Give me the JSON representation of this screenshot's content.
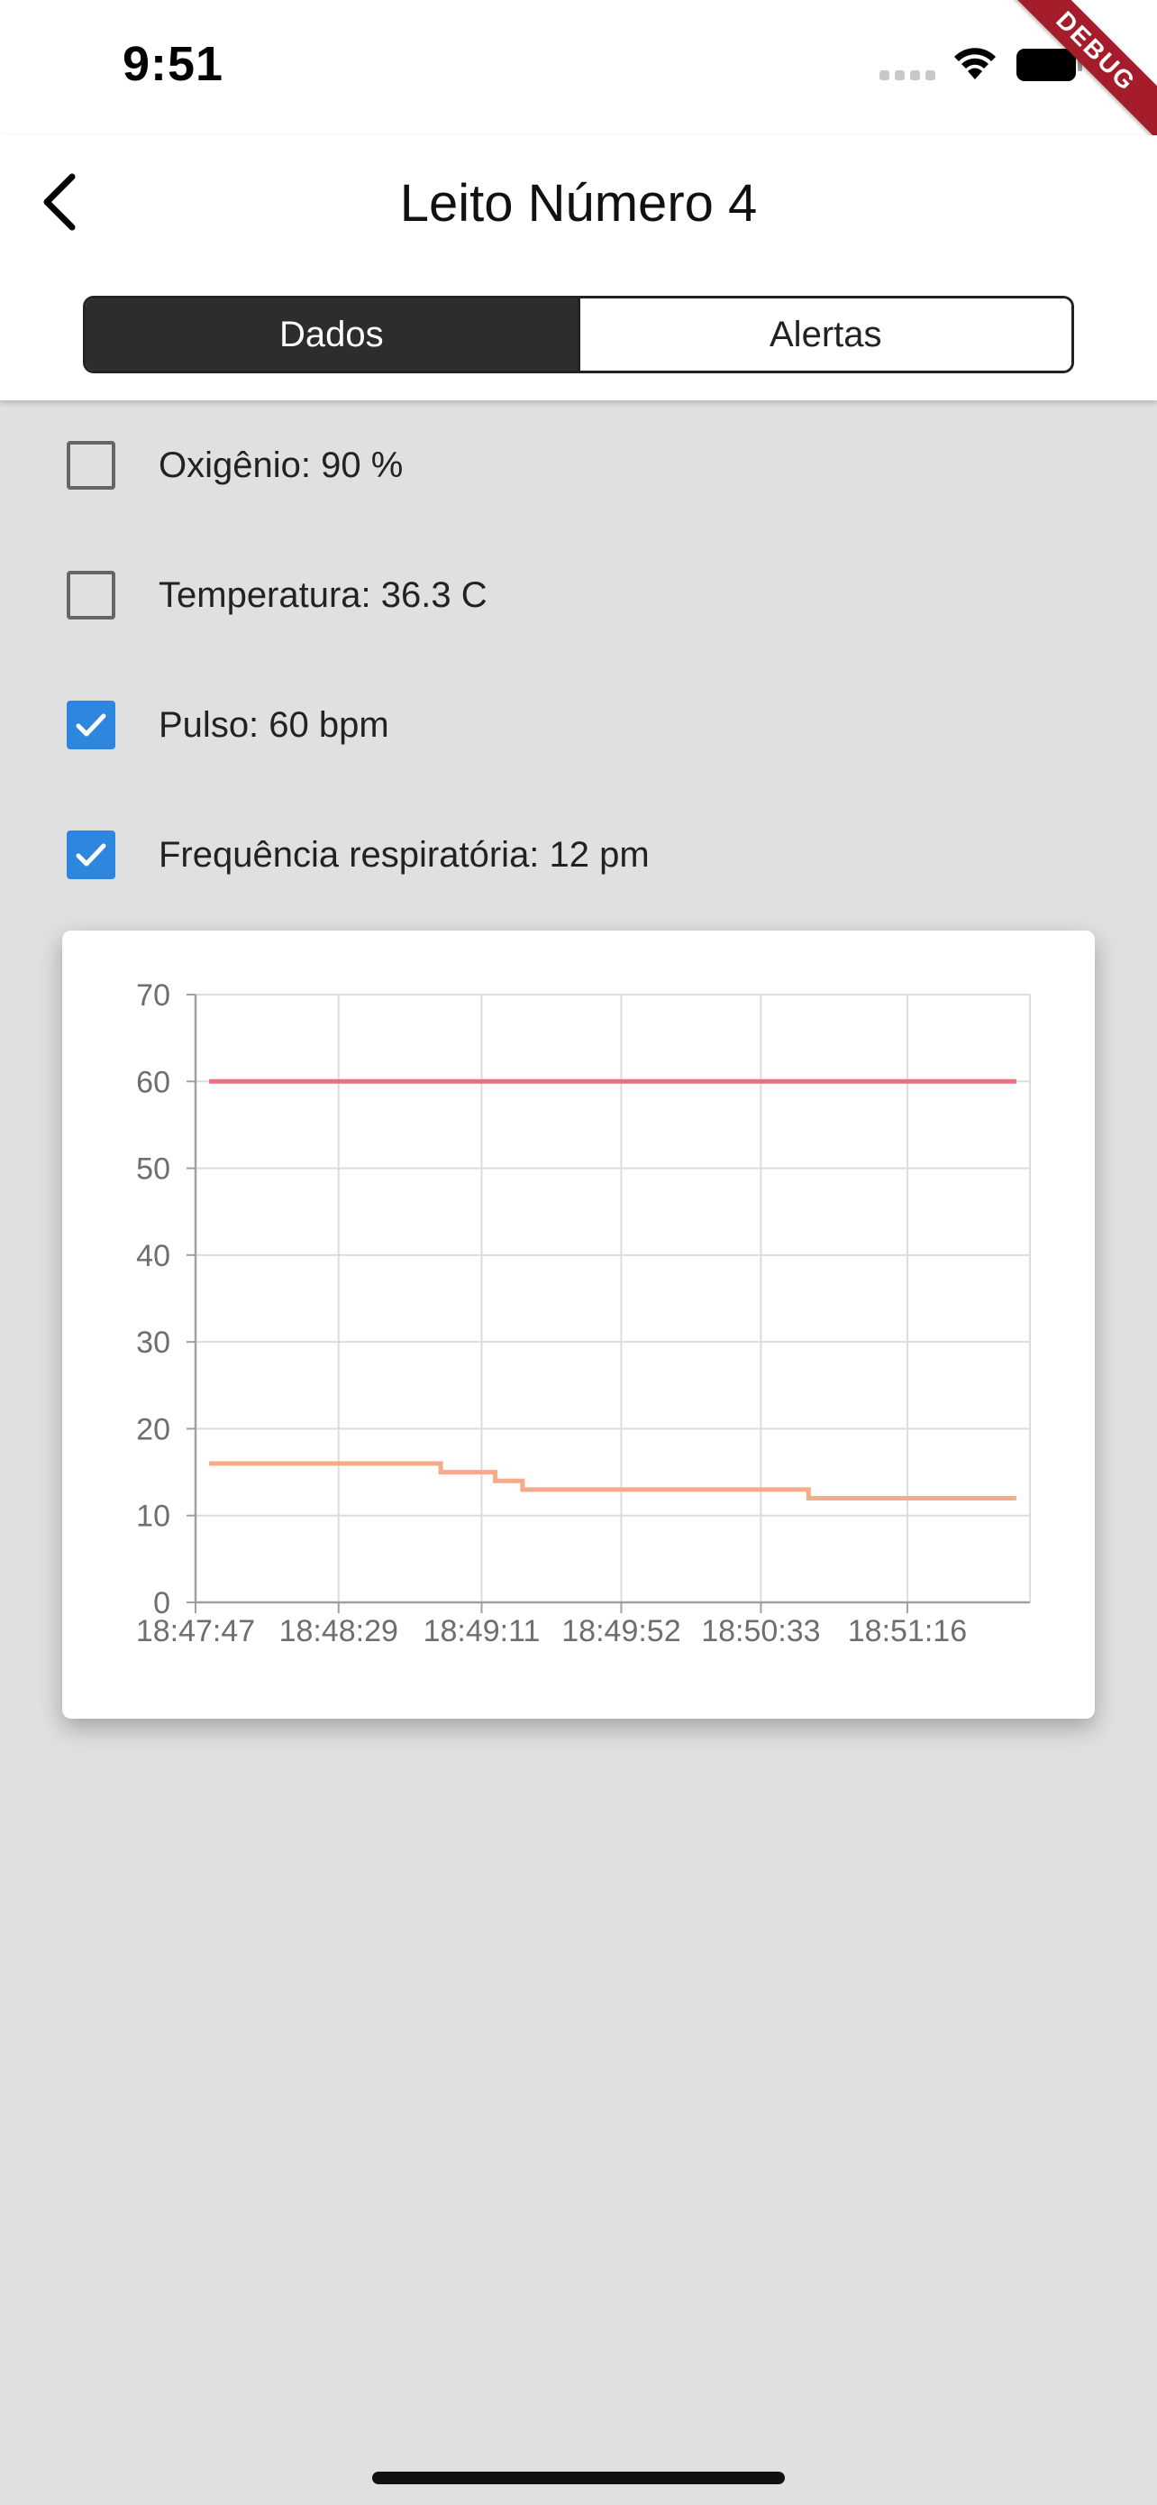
{
  "status_bar": {
    "time": "9:51",
    "wifi_icon": "wifi-icon",
    "battery_icon": "battery-icon",
    "signal_icon": "cellular-signal-icon"
  },
  "debug_banner": "DEBUG",
  "app_bar": {
    "back_icon": "chevron-left-icon",
    "title": "Leito Número 4",
    "tabs": [
      {
        "label": "Dados",
        "active": true
      },
      {
        "label": "Alertas",
        "active": false
      }
    ]
  },
  "metrics": [
    {
      "label": "Oxigênio: 90 %",
      "checked": false
    },
    {
      "label": "Temperatura: 36.3 C",
      "checked": false
    },
    {
      "label": "Pulso: 60 bpm",
      "checked": true
    },
    {
      "label": "Frequência respiratória: 12 pm",
      "checked": true
    }
  ],
  "colors": {
    "checked": "#2e86de",
    "pulse_line": "#e8707f",
    "resp_line": "#f4ab88",
    "grid": "#dcdcdc",
    "axis": "#a0a0a0",
    "tick_text": "#6e6e6e"
  },
  "chart_data": {
    "type": "line",
    "title": "",
    "xlabel": "",
    "ylabel": "",
    "ylim": [
      0,
      70
    ],
    "yticks": [
      0,
      10,
      20,
      30,
      40,
      50,
      60,
      70
    ],
    "x_tick_labels": [
      "18:47:47",
      "18:48:29",
      "18:49:11",
      "18:49:52",
      "18:50:33",
      "18:51:16"
    ],
    "x_range": [
      "18:47:47",
      "18:51:52"
    ],
    "grid": true,
    "legend": "none",
    "series": [
      {
        "color": "#e8707f",
        "x": [
          "18:47:51",
          "18:51:48"
        ],
        "y": [
          60,
          60
        ],
        "step": true
      },
      {
        "color": "#f4ab88",
        "x": [
          "18:47:51",
          "18:48:59",
          "18:49:15",
          "18:49:23",
          "18:50:47",
          "18:51:48"
        ],
        "y": [
          16,
          15,
          14,
          13,
          12,
          12
        ],
        "step": true
      }
    ]
  }
}
